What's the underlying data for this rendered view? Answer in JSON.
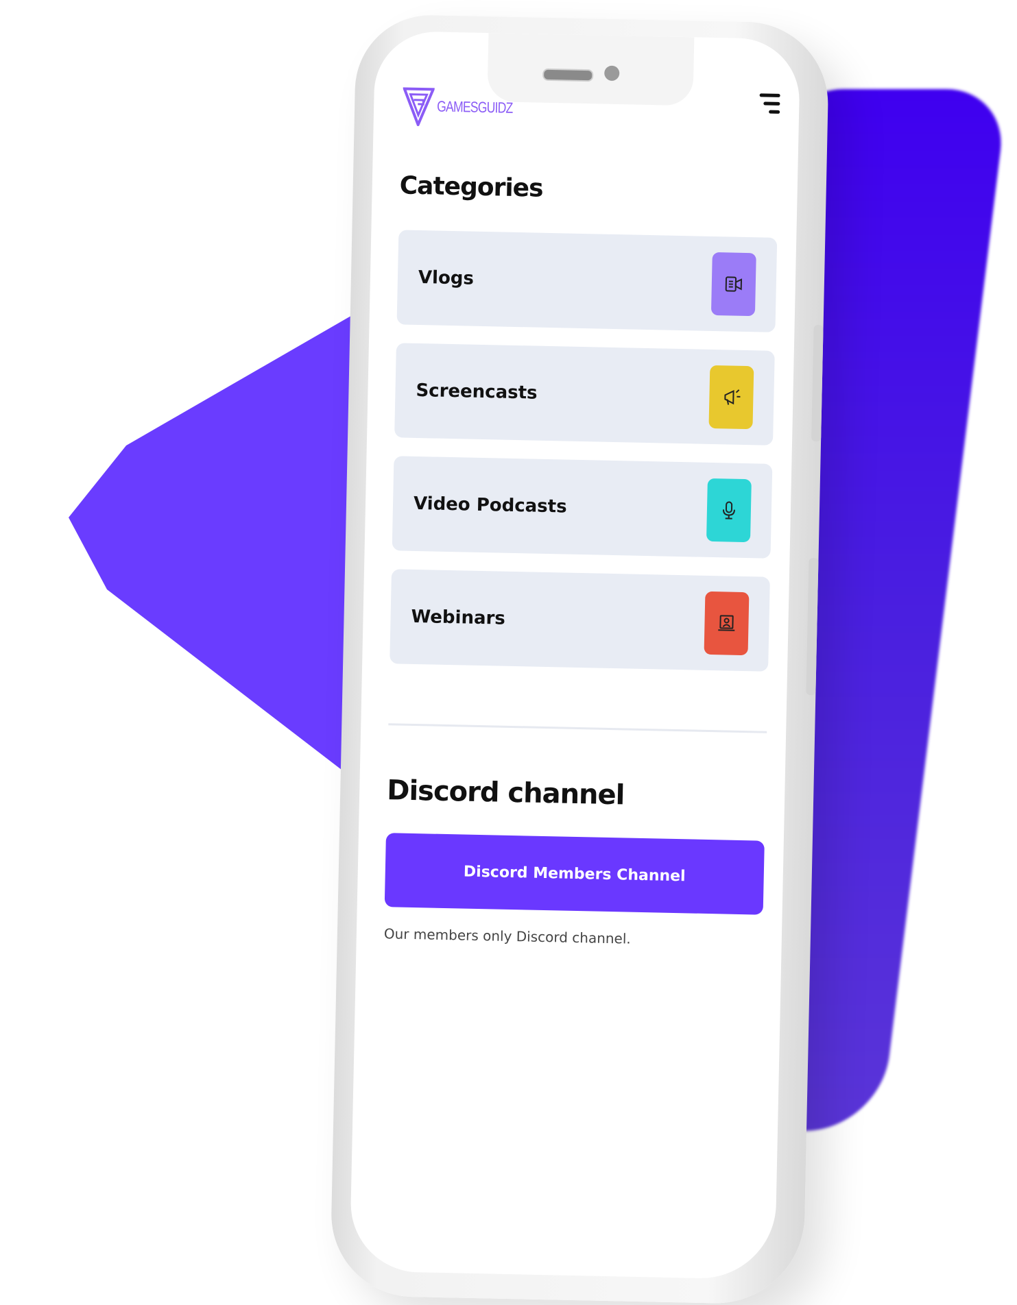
{
  "header": {
    "logo_text": "GAMESGUIDZ"
  },
  "categories": {
    "title": "Categories",
    "items": [
      {
        "label": "Vlogs",
        "icon": "video-icon",
        "color": "#9b7cf7"
      },
      {
        "label": "Screencasts",
        "icon": "megaphone-icon",
        "color": "#e8c82e"
      },
      {
        "label": "Video Podcasts",
        "icon": "microphone-icon",
        "color": "#2dd6d6"
      },
      {
        "label": "Webinars",
        "icon": "presentation-icon",
        "color": "#e8553f"
      }
    ]
  },
  "discord": {
    "title": "Discord channel",
    "button_label": "Discord Members Channel",
    "description": "Our members only Discord channel."
  },
  "colors": {
    "accent": "#6a38ff",
    "card_bg": "#e8ecf4"
  }
}
